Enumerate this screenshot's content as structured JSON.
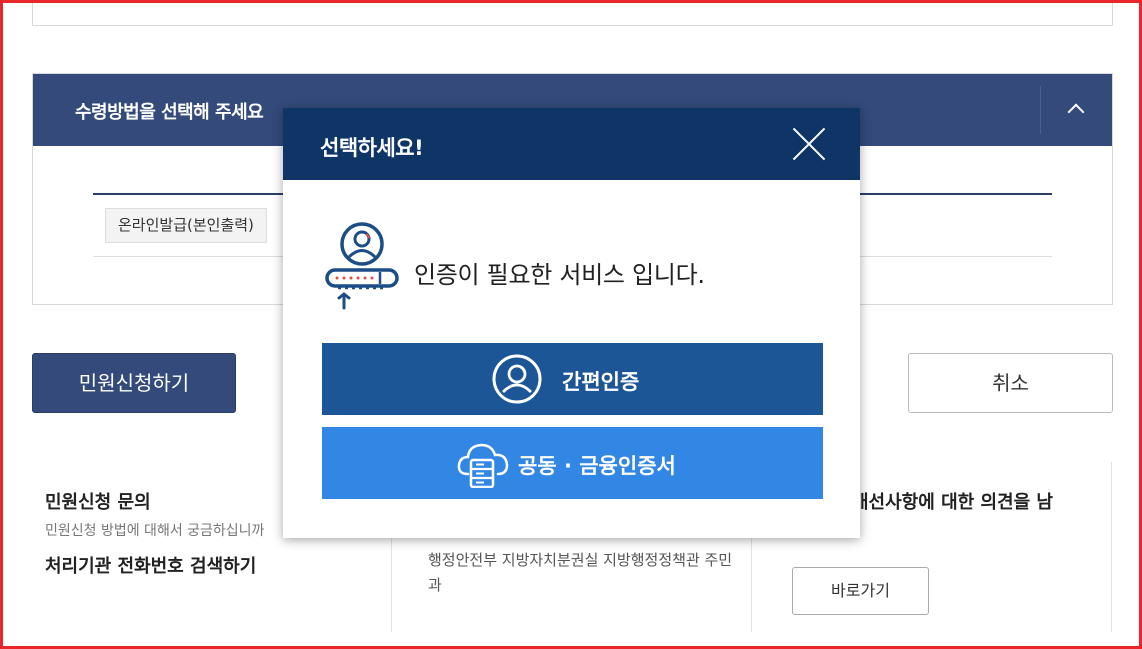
{
  "section": {
    "title": "수령방법을 선택해 주세요",
    "method_tag": "온라인발급(본인출력)"
  },
  "actions": {
    "apply_label": "민원신청하기",
    "cancel_label": "취소"
  },
  "inquiry": {
    "title": "민원신청 문의",
    "desc": "민원신청 방법에 대해서 궁금하십니까",
    "link": "처리기관 전화번호 검색하기"
  },
  "org": {
    "name": "행정안전부 지방자치분권실 지방행정정책관 주민과"
  },
  "feedback": {
    "title": "개선사항에 대한 의견을 남",
    "go_label": "바로가기"
  },
  "modal": {
    "title": "선택하세요!",
    "message": "인증이 필요한 서비스 입니다.",
    "simple_auth_label": "간편인증",
    "cert_auth_label": "공동 · 금융인증서"
  },
  "colors": {
    "frame": "#e8262b",
    "section_header": "#334a7a",
    "modal_header": "#0f3567",
    "simple_auth_button": "#1c5697",
    "cert_auth_button": "#3286e4"
  }
}
